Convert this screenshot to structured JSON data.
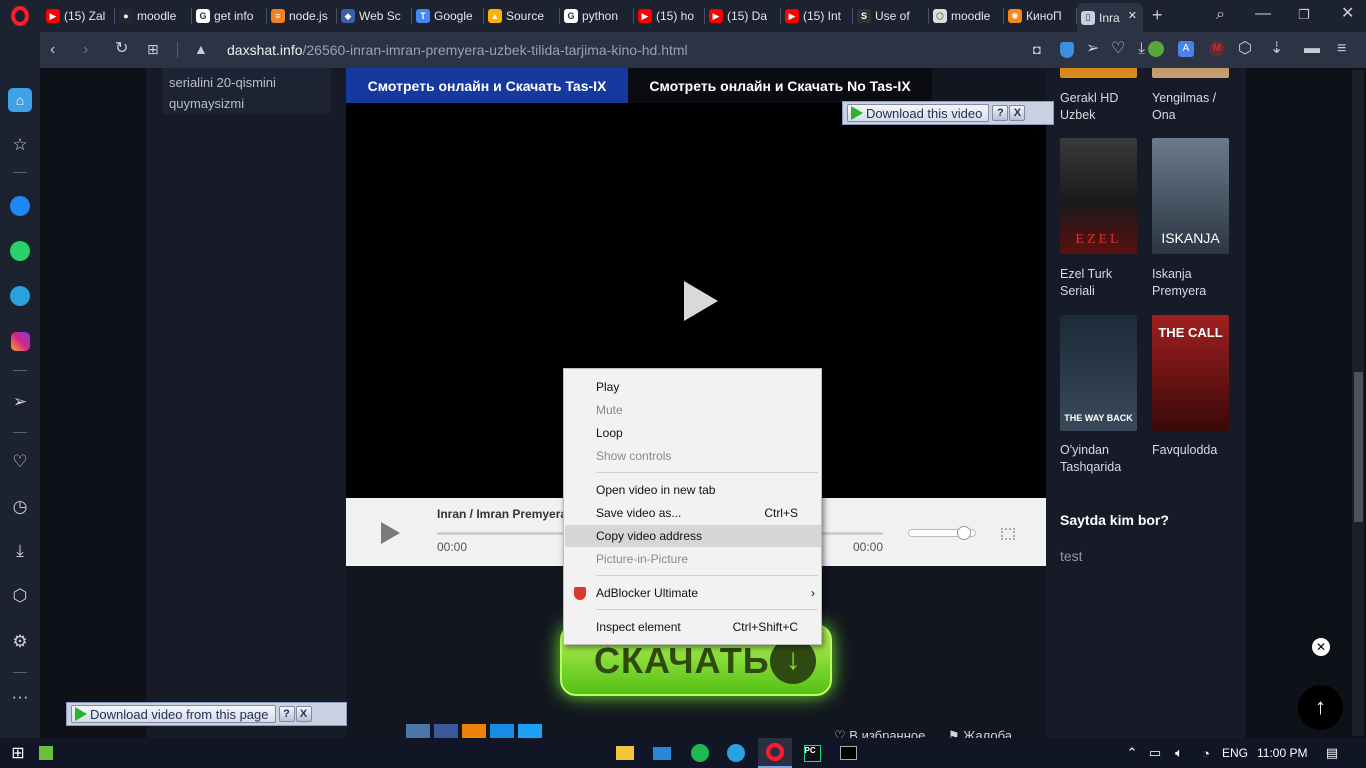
{
  "browser": {
    "tabs": [
      {
        "label": "(15) Zal",
        "color": "#ff0000",
        "glyph": "▶"
      },
      {
        "label": "moodle",
        "color": "#24292e",
        "glyph": "●"
      },
      {
        "label": "get info",
        "color": "#ffffff",
        "glyph": "G"
      },
      {
        "label": "node.js",
        "color": "#f48024",
        "glyph": "≡"
      },
      {
        "label": "Web Sc",
        "color": "#3b5ea8",
        "glyph": "◆"
      },
      {
        "label": "Google",
        "color": "#4285f4",
        "glyph": "T"
      },
      {
        "label": "Source",
        "color": "#ffb100",
        "glyph": "▲"
      },
      {
        "label": "python",
        "color": "#ffffff",
        "glyph": "G"
      },
      {
        "label": "(15) ho",
        "color": "#ff0000",
        "glyph": "▶"
      },
      {
        "label": "(15) Da",
        "color": "#ff0000",
        "glyph": "▶"
      },
      {
        "label": "(15) Int",
        "color": "#ff0000",
        "glyph": "▶"
      },
      {
        "label": "Use of",
        "color": "#333333",
        "glyph": "S"
      },
      {
        "label": "moodle",
        "color": "#dddddd",
        "glyph": "⬡"
      },
      {
        "label": "КиноП",
        "color": "#f5891f",
        "glyph": "✺"
      },
      {
        "label": "Inra",
        "color": "#c8d0e0",
        "glyph": "▯",
        "active": true
      }
    ],
    "url_domain": "daxshat.info",
    "url_path": "/26560-inran-imran-premyera-uzbek-tilida-tarjima-kino-hd.html"
  },
  "page": {
    "left_card_text_1": "serialini 20-qismini",
    "left_card_text_2": "quymaysizmi",
    "server_tabs": [
      "Смотреть онлайн и Скачать Tas-IX",
      "Смотреть онлайн и Скачать No Tas-IX"
    ],
    "player": {
      "title": "Inran / Imran Premyera",
      "time_current": "00:00",
      "time_total": "00:00"
    },
    "download_button": "СКАЧАТЬ",
    "favorite_label": "В избранное",
    "complaint_label": "Жалоба",
    "sidebar_movies": [
      {
        "title": "Gerakl HD Uzbek"
      },
      {
        "title": "Yengilmas / Ona"
      },
      {
        "title": "Ezel Turk Seriali",
        "poster_text": "EZEL"
      },
      {
        "title": "Iskanja Premyera",
        "poster_text": "ISKANJA"
      },
      {
        "title": "O'yindan Tashqarida",
        "poster_text": "THE WAY BACK"
      },
      {
        "title": "Favqulodda",
        "poster_text": "THE CALL"
      }
    ],
    "who_online_title": "Saytda kim bor?",
    "who_online_user": "test"
  },
  "context_menu": {
    "items": [
      {
        "label": "Play",
        "disabled": false
      },
      {
        "label": "Mute",
        "disabled": true
      },
      {
        "label": "Loop",
        "disabled": false
      },
      {
        "label": "Show controls",
        "disabled": true
      },
      {
        "label": "Open video in new tab",
        "disabled": false
      },
      {
        "label": "Save video as...",
        "shortcut": "Ctrl+S",
        "disabled": false
      },
      {
        "label": "Copy video address",
        "disabled": false,
        "highlighted": true
      },
      {
        "label": "Picture-in-Picture",
        "disabled": true
      },
      {
        "label": "AdBlocker Ultimate",
        "disabled": false,
        "submenu": true
      },
      {
        "label": "Inspect element",
        "shortcut": "Ctrl+Shift+C",
        "disabled": false
      }
    ]
  },
  "overlays": {
    "download_video": "Download this video",
    "download_page": "Download video from this page",
    "help": "?",
    "close": "X"
  },
  "taskbar": {
    "language": "ENG",
    "time": "11:00 PM"
  }
}
